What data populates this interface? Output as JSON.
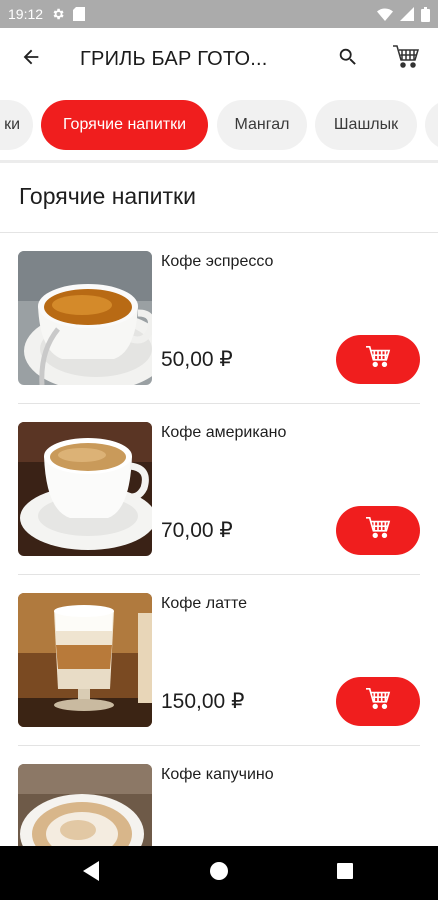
{
  "status_bar": {
    "time": "19:12",
    "icons": [
      "gear-icon",
      "sd-card-icon",
      "wifi-icon",
      "signal-icon",
      "battery-icon"
    ]
  },
  "app_bar": {
    "title": "ГРИЛЬ БАР ГОТО...",
    "icons": [
      "back-arrow-icon",
      "search-icon",
      "cart-icon"
    ]
  },
  "categories": [
    {
      "label": "ки",
      "active": false
    },
    {
      "label": "Горячие напитки",
      "active": true
    },
    {
      "label": "Мангал",
      "active": false
    },
    {
      "label": "Шашлык",
      "active": false
    },
    {
      "label": "",
      "active": false
    }
  ],
  "section": {
    "title": "Горячие напитки"
  },
  "products": [
    {
      "name": "Кофе эспрессо",
      "price": "50,00 ₽"
    },
    {
      "name": "Кофе американо",
      "price": "70,00 ₽"
    },
    {
      "name": "Кофе латте",
      "price": "150,00 ₽"
    },
    {
      "name": "Кофе капучино",
      "price": ""
    }
  ],
  "nav_bar": {
    "icons": [
      "nav-back-icon",
      "nav-home-icon",
      "nav-recents-icon"
    ]
  },
  "colors": {
    "accent": "#f01e1e",
    "status_bar": "#ababab",
    "chip_inactive": "#f1f1f1",
    "nav_bar": "#000000"
  }
}
